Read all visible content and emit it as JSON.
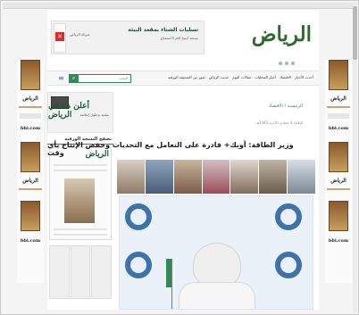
{
  "browser": {
    "accent_color": "#2e8b57"
  },
  "ad_banner": {
    "title": "تسليات الشتاء بمقعد البيئة",
    "subtitle": "يستعد ليتيح لكم الاستمتاع",
    "brand": "شركة الرياض"
  },
  "brand": {
    "logo_text": "الرياض"
  },
  "navbar": {
    "items": [
      "أحدث الأخبار",
      "الاقتصاد",
      "أخبار المحليات",
      "مقالات اليوم",
      "حديث الرياض",
      "صور من الصحيفة الورقية"
    ],
    "search_placeholder": "البحث",
    "menu_icon": "menu-icon",
    "search_icon": "search-icon"
  },
  "sidebar": {
    "ad_text": "أعلن هنا في الرياض",
    "ad_sub": "بتقنية وحلول إعلانية",
    "heading": "تصفح النسخة الورقية",
    "masthead": "الرياض"
  },
  "side_ads": {
    "logo": "الرياض",
    "tag": "bbi.com"
  },
  "article": {
    "breadcrumb": "الرئيسية / الاقتصاد",
    "meta": "الثلاثاء 4 جمادى الآخرة 1443هـ",
    "title": "وزير الطاقة: أوبك+ قادرة على التعامل مع التحديات وخفض الإنتاج بأي وقت"
  }
}
